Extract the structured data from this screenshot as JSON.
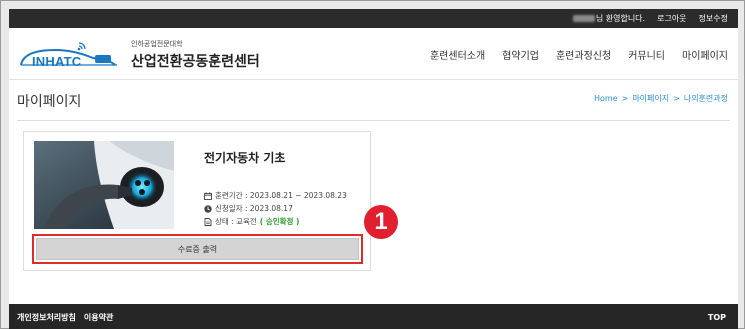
{
  "topbar": {
    "welcome": "님 환영합니다.",
    "logout": "로그아웃",
    "edit_info": "정보수정"
  },
  "header": {
    "logo_en": "INHATC",
    "logo_sub": "인하공업전문대학",
    "logo_title": "산업전환공동훈련센터",
    "accent": "#1a78c2",
    "nav": [
      {
        "label": "훈련센터소개"
      },
      {
        "label": "협약기업"
      },
      {
        "label": "훈련과정신청"
      },
      {
        "label": "커뮤니티"
      },
      {
        "label": "마이페이지"
      }
    ]
  },
  "page": {
    "title": "마이페이지",
    "breadcrumb": [
      "Home",
      "마이페이지",
      "나의훈련과정"
    ],
    "breadcrumb_sep": ">"
  },
  "course": {
    "title": "전기자동차 기초",
    "period": "훈련기간 : 2023.08.21 ~ 2023.08.23",
    "apply_date": "신청일자 : 2023.08.17",
    "status_prefix": "상태 : 교육전",
    "status_value": "( 승인확정 )",
    "status_color": "#2c9a2c",
    "certificate_button": "수료증 출력"
  },
  "annotation": {
    "number": "1",
    "color": "#e01f2f"
  },
  "footer": {
    "privacy": "개인정보처리방침",
    "terms": "이용약관",
    "top": "TOP"
  }
}
